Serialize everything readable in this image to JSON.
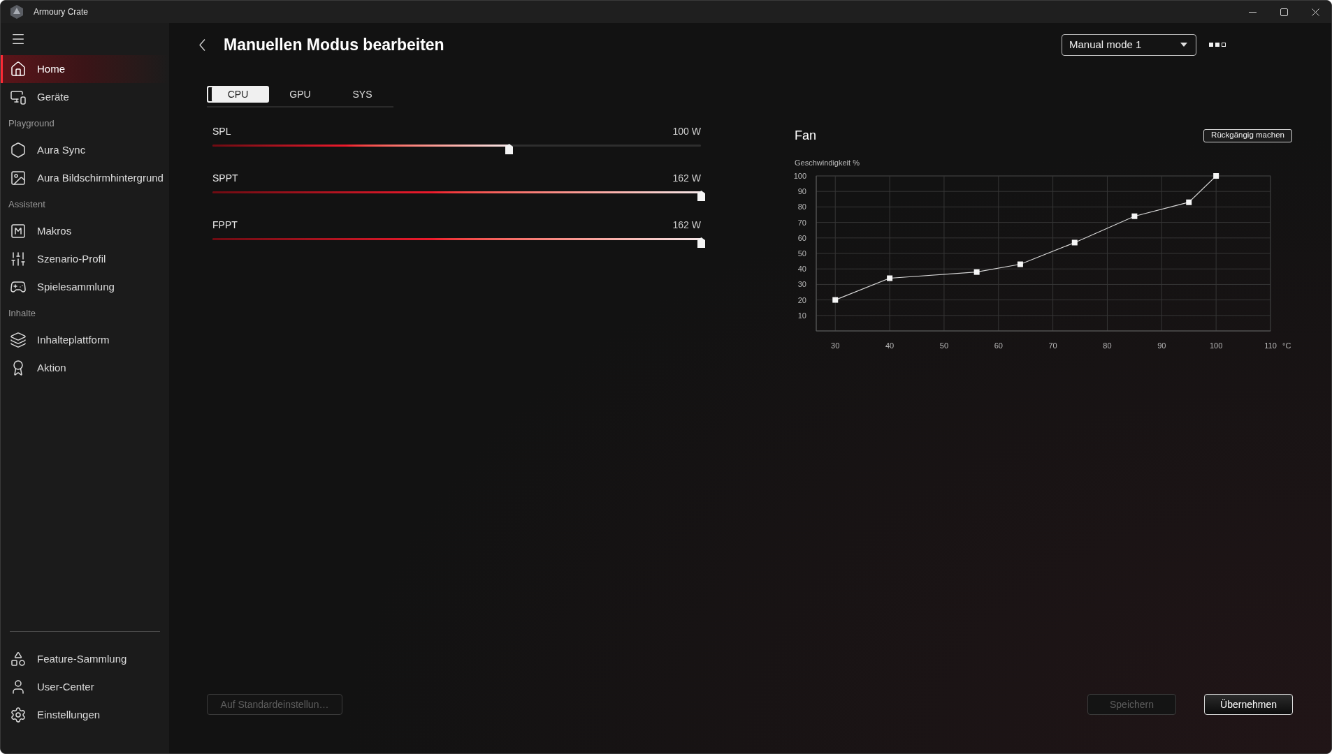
{
  "window": {
    "title": "Armoury Crate"
  },
  "sidebar": {
    "items": [
      {
        "kind": "item",
        "label": "Home",
        "selected": true
      },
      {
        "kind": "item",
        "label": "Geräte",
        "selected": false
      },
      {
        "kind": "section",
        "label": "Playground"
      },
      {
        "kind": "item",
        "label": "Aura Sync",
        "selected": false
      },
      {
        "kind": "item",
        "label": "Aura Bildschirmhintergrund",
        "selected": false
      },
      {
        "kind": "section",
        "label": "Assistent"
      },
      {
        "kind": "item",
        "label": "Makros",
        "selected": false
      },
      {
        "kind": "item",
        "label": "Szenario-Profil",
        "selected": false
      },
      {
        "kind": "item",
        "label": "Spielesammlung",
        "selected": false
      },
      {
        "kind": "section",
        "label": "Inhalte"
      },
      {
        "kind": "item",
        "label": "Inhalteplattform",
        "selected": false
      },
      {
        "kind": "item",
        "label": "Aktion",
        "selected": false
      }
    ],
    "footer_items": [
      {
        "label": "Feature-Sammlung",
        "selected": false
      },
      {
        "label": "User-Center",
        "selected": false
      },
      {
        "label": "Einstellungen",
        "selected": false
      }
    ]
  },
  "header": {
    "title": "Manuellen Modus bearbeiten",
    "mode_dropdown": {
      "value": "Manual mode 1"
    }
  },
  "tabs": [
    {
      "label": "CPU",
      "selected": true
    },
    {
      "label": "GPU",
      "selected": false
    },
    {
      "label": "SYS",
      "selected": false
    }
  ],
  "sliders": [
    {
      "name": "SPL",
      "reading": "100 W",
      "level": 0.608
    },
    {
      "name": "SPPT",
      "reading": "162 W",
      "level": 1
    },
    {
      "name": "FPPT",
      "reading": "162 W",
      "level": 1
    }
  ],
  "fan": {
    "title": "Fan",
    "reset_button": "Rückgängig machen",
    "chart_data": {
      "type": "line",
      "ylabel": "Geschwindigkeit %",
      "xlabel": "°C",
      "x": [
        30,
        40,
        56,
        64,
        74,
        85,
        95,
        100
      ],
      "values": [
        20,
        34,
        38,
        43,
        57,
        74,
        83,
        100
      ],
      "xlim": [
        26.5,
        110
      ],
      "ylim": [
        0,
        100
      ],
      "xticks": [
        30,
        40,
        50,
        60,
        70,
        80,
        90,
        100,
        110
      ],
      "yticks": [
        10,
        20,
        30,
        40,
        50,
        60,
        70,
        80,
        90,
        100
      ],
      "grid": true,
      "marker": "square"
    }
  },
  "footer": {
    "left_buttons": [
      {
        "label": "Auf Standardeinstellun…",
        "disabled": true
      }
    ],
    "right_buttons": [
      {
        "label": "Speichern",
        "disabled": true
      },
      {
        "label": "Übernehmen",
        "disabled": false
      }
    ]
  }
}
